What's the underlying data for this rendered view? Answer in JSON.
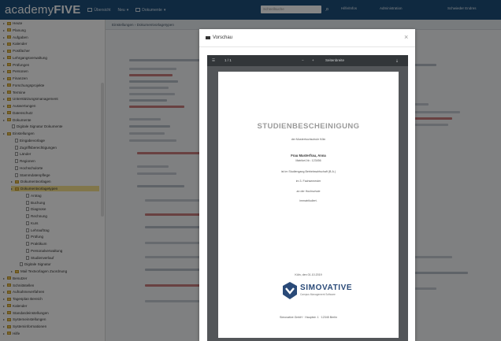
{
  "app": {
    "logo_prefix": "academy",
    "logo_suffix": "FIVE"
  },
  "topbar": {
    "nav": [
      "Übersicht",
      "Neu",
      "Dokumente"
    ],
    "search_placeholder": "Schnellsuche",
    "search_icon": "search-icon",
    "right_items": [
      "Hilfe/Infos",
      "Administration",
      "Schwieder Endres"
    ]
  },
  "sidebar": {
    "items": [
      {
        "label": "Heute",
        "icon": "folder-icon"
      },
      {
        "label": "Planung",
        "icon": "folder-icon"
      },
      {
        "label": "Aufgaben",
        "icon": "folder-icon"
      },
      {
        "label": "Kalender",
        "icon": "folder-icon"
      },
      {
        "label": "Postfächer",
        "icon": "folder-icon"
      },
      {
        "label": "Lehrgangsverwaltung",
        "icon": "folder-icon"
      },
      {
        "label": "Prüfungen",
        "icon": "folder-icon"
      },
      {
        "label": "Personen",
        "icon": "folder-icon"
      },
      {
        "label": "Finanzen",
        "icon": "folder-icon"
      },
      {
        "label": "Forschungsprojekte",
        "icon": "folder-icon"
      },
      {
        "label": "Termine",
        "icon": "folder-icon"
      },
      {
        "label": "Unterstützungsmanagement",
        "icon": "folder-icon"
      },
      {
        "label": "Auswertungen",
        "icon": "folder-icon"
      },
      {
        "label": "Datenschutz",
        "icon": "folder-icon"
      },
      {
        "label": "Dokumente",
        "icon": "folder-icon"
      },
      {
        "label": "Digitale Signatur Dokumente",
        "icon": "doc-icon"
      },
      {
        "label": "Einstellungen",
        "icon": "folder-icon"
      },
      {
        "label": "Eingabevorlage",
        "icon": "doc-icon"
      },
      {
        "label": "Zugriffsberechtigungen",
        "icon": "doc-icon"
      },
      {
        "label": "Länder",
        "icon": "doc-icon"
      },
      {
        "label": "Regionen",
        "icon": "doc-icon"
      },
      {
        "label": "Hochschulorte",
        "icon": "doc-icon"
      },
      {
        "label": "Stammdatenpflege",
        "icon": "doc-icon"
      },
      {
        "label": "Dokumentvorlagen",
        "icon": "folder-icon"
      },
      {
        "label": "Dokumentvorlagetypen",
        "icon": "folder-icon",
        "selected": true
      },
      {
        "label": "Antrag",
        "icon": "doc-icon"
      },
      {
        "label": "Buchung",
        "icon": "doc-icon"
      },
      {
        "label": "Diagnose",
        "icon": "doc-icon"
      },
      {
        "label": "Rechnung",
        "icon": "doc-icon"
      },
      {
        "label": "Kurs",
        "icon": "doc-icon"
      },
      {
        "label": "Lehrauftrag",
        "icon": "doc-icon"
      },
      {
        "label": "Prüfung",
        "icon": "doc-icon"
      },
      {
        "label": "Praktikum",
        "icon": "doc-icon"
      },
      {
        "label": "Personalverwaltung",
        "icon": "doc-icon"
      },
      {
        "label": "Studienverlauf",
        "icon": "doc-icon"
      },
      {
        "label": "Digitale Signatur",
        "icon": "doc-icon"
      },
      {
        "label": "Mail Textvorlagen Zuordnung",
        "icon": "folder-icon"
      },
      {
        "label": "Benutzer",
        "icon": "folder-icon"
      },
      {
        "label": "Schnittstellen",
        "icon": "folder-icon"
      },
      {
        "label": "Aufnahmeverfahren",
        "icon": "folder-icon"
      },
      {
        "label": "Tagesplan Bereich",
        "icon": "folder-icon"
      },
      {
        "label": "Kalender",
        "icon": "folder-icon"
      },
      {
        "label": "Standardeinstellungen",
        "icon": "folder-icon"
      },
      {
        "label": "Systemeinstellungen",
        "icon": "folder-icon"
      },
      {
        "label": "Systeminformationen",
        "icon": "folder-icon"
      },
      {
        "label": "Hilfe",
        "icon": "folder-icon"
      }
    ]
  },
  "main": {
    "breadcrumb": "Einstellungen  ›  Dokumentvorlagetypen"
  },
  "modal": {
    "title": "Vorschau",
    "title_icon": "preview-icon",
    "close_icon": "close-icon"
  },
  "viewer": {
    "menu_icon": "menu-icon",
    "page_counter": "1 / 1",
    "zoom_minus": "−",
    "zoom_plus": "+",
    "fit_label": "Seitenbreite",
    "download_icon": "download-icon"
  },
  "pdf": {
    "title": "STUDIENBESCHEINIGUNG",
    "lines": [
      "der Musterhochschule Köln",
      "Frau Musterfrau, Anna",
      "Matrikel-Nr.: 123456",
      "ist im Studiengang Betriebswirtschaft (B.A.)",
      "im 3. Fachsemester",
      "an der Hochschule",
      "immatrikuliert."
    ],
    "date_line": "Köln, den 01.10.2019",
    "logo_name": "SIMOVATIVE",
    "logo_sub": "Campus Management Software",
    "footer": "Simovative GmbH · Hauptstr. 1 · 12345 Berlin",
    "brand_color": "#2a4a78"
  },
  "colors": {
    "topbar": "#1d4f7c",
    "selected_tree": "#f7e38f",
    "overlay": "#000000"
  }
}
